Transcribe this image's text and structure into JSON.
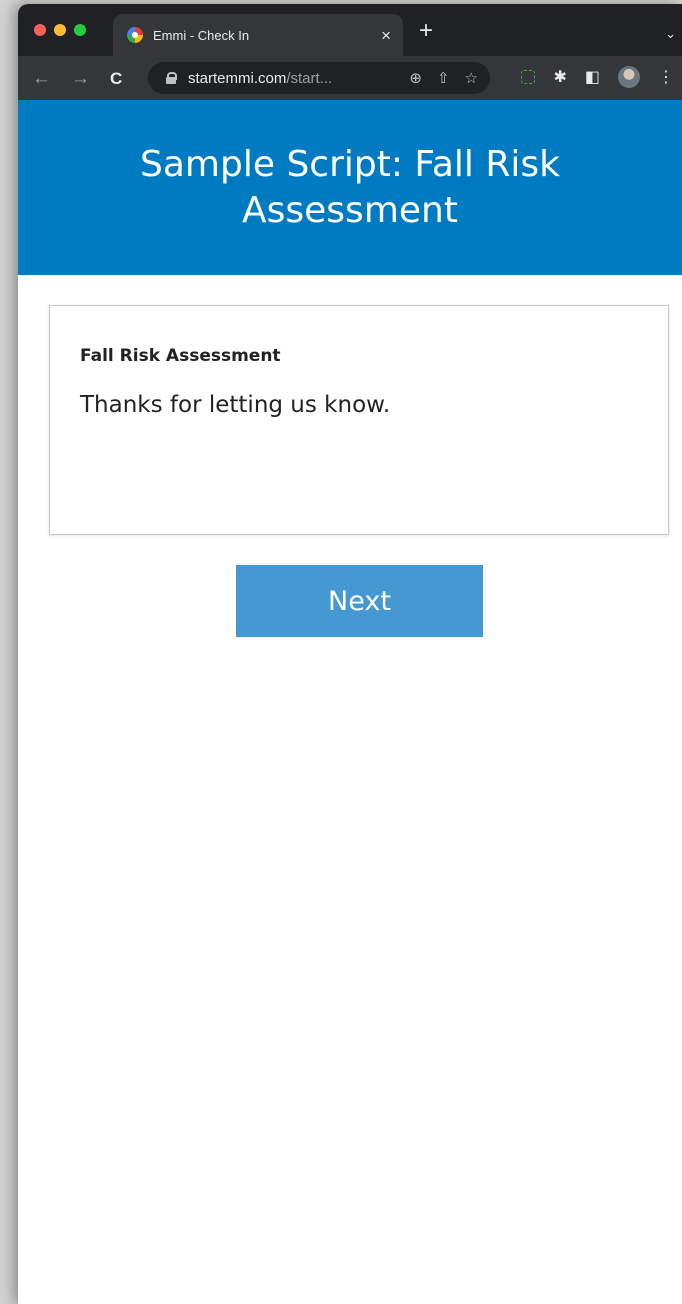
{
  "browser": {
    "tab_title": "Emmi - Check In",
    "close_glyph": "×",
    "newtab_glyph": "+",
    "dropdown_glyph": "⌄",
    "url_host": "startemmi.com",
    "url_path": "/start...",
    "nav": {
      "back": "←",
      "forward": "→",
      "reload": "C"
    },
    "omnibox_icons": {
      "zoom": "⊕",
      "share": "⇧",
      "bookmark": "☆"
    },
    "toolbar_icons": {
      "extensions": "✱",
      "sidepanel": "◧",
      "menu": "⋮"
    }
  },
  "page": {
    "title": "Sample Script: Fall Risk Assessment",
    "header_color": "#007bc2",
    "card": {
      "label": "Fall Risk Assessment",
      "message": "Thanks for letting us know."
    },
    "next_button": "Next",
    "button_color": "#4499d2"
  }
}
